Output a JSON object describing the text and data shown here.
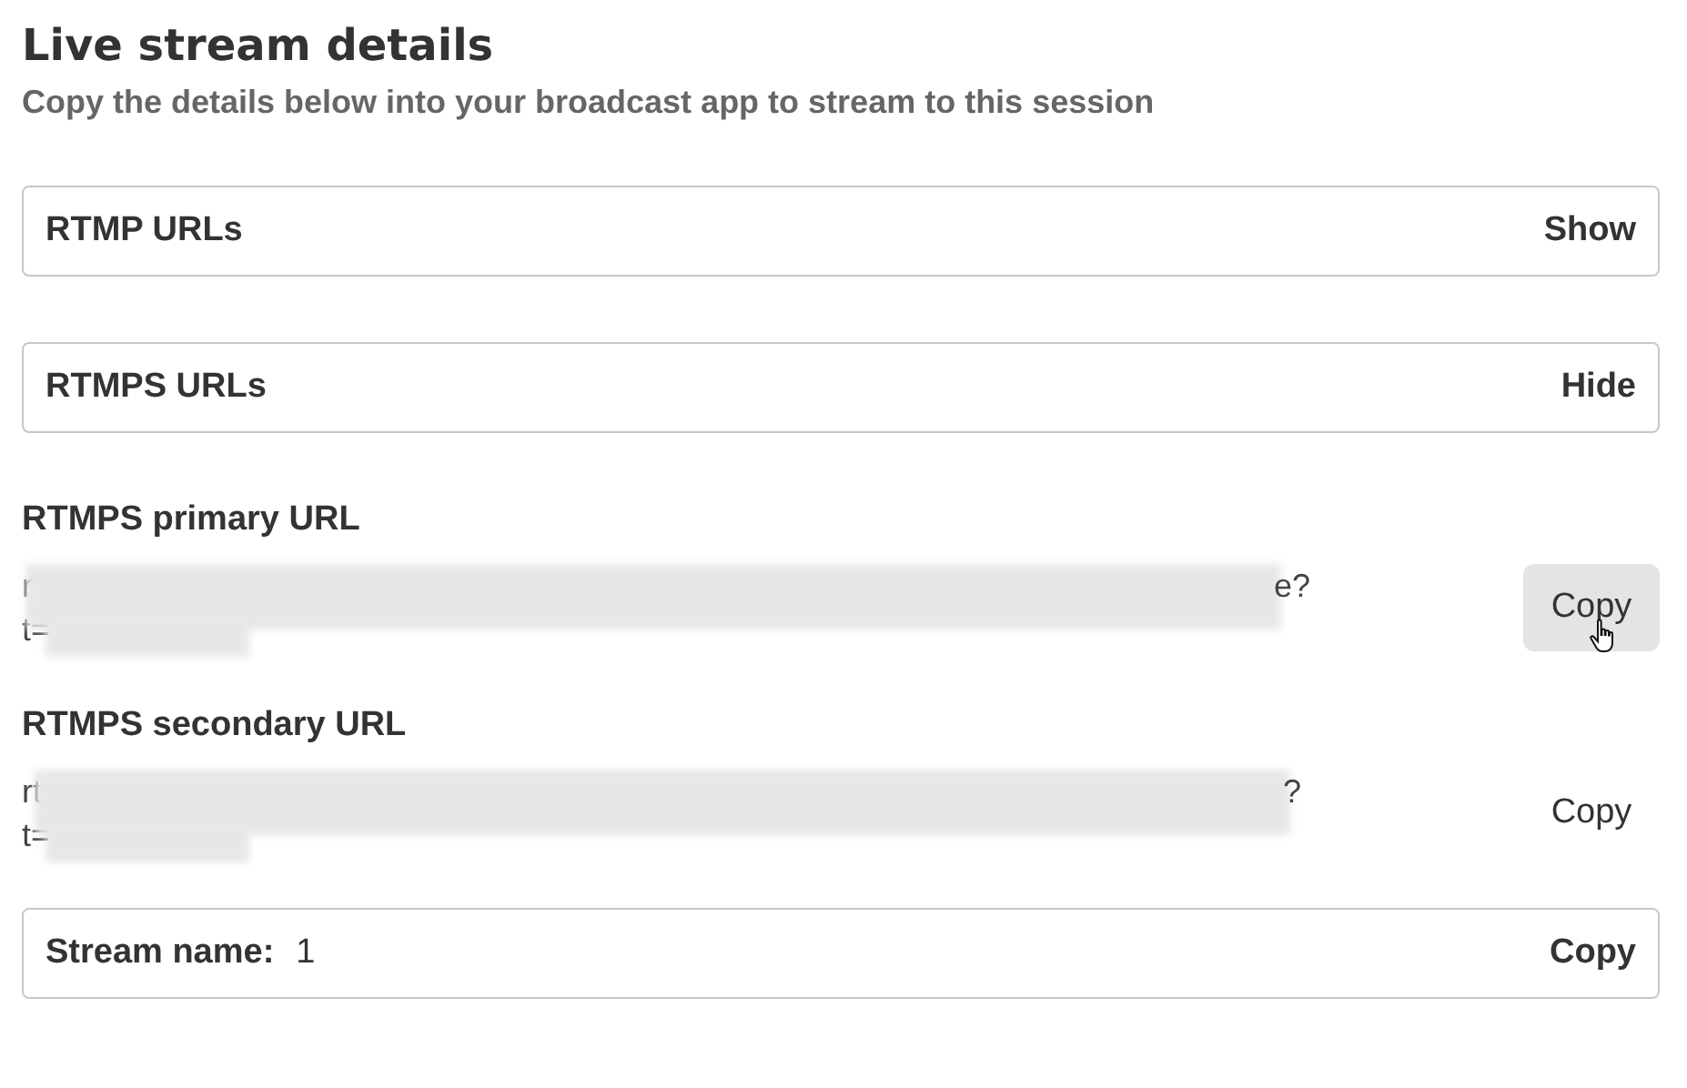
{
  "title": "Live stream details",
  "subtitle": "Copy the details below into your broadcast app to stream to this session",
  "sections": [
    {
      "kind": "toggle",
      "label": "RTMP URLs",
      "action": "Show"
    },
    {
      "kind": "toggle",
      "label": "RTMPS URLs",
      "action": "Hide"
    },
    {
      "kind": "url",
      "label": "RTMPS primary URL",
      "lines": [
        {
          "start": "r",
          "end": "e?"
        },
        {
          "start": "t="
        }
      ],
      "button": {
        "label": "Copy",
        "hovered": true
      }
    },
    {
      "kind": "url",
      "label": "RTMPS secondary URL",
      "lines": [
        {
          "start": "rt",
          "end": "?"
        },
        {
          "start": "t="
        }
      ],
      "button": {
        "label": "Copy",
        "hovered": false
      }
    },
    {
      "kind": "field",
      "label": "Stream name:",
      "value": "1",
      "action": "Copy"
    }
  ]
}
